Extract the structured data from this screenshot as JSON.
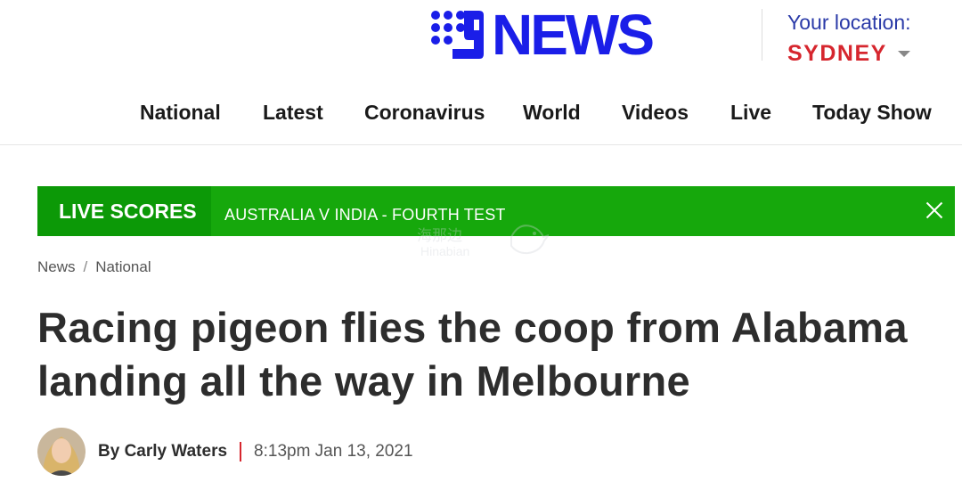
{
  "brand": {
    "logo_text": "NEWS",
    "logo_color": "#1a1ee8"
  },
  "location": {
    "label": "Your location:",
    "city": "SYDNEY",
    "city_color": "#d6262e"
  },
  "nav": [
    "National",
    "Latest",
    "Coronavirus",
    "World",
    "Videos",
    "Live",
    "Today Show"
  ],
  "scores_bar": {
    "label": "LIVE SCORES",
    "match": "AUSTRALIA V INDIA - FOURTH TEST",
    "bar_color": "#16a80c"
  },
  "watermark": {
    "cn": "海那边",
    "en": "Hinabian"
  },
  "breadcrumb": [
    "News",
    "National"
  ],
  "breadcrumb_separator": "/",
  "article": {
    "headline": "Racing pigeon flies the coop from Alabama landing all the way in Melbourne",
    "author": "By Carly Waters",
    "timestamp": "8:13pm Jan 13, 2021"
  }
}
